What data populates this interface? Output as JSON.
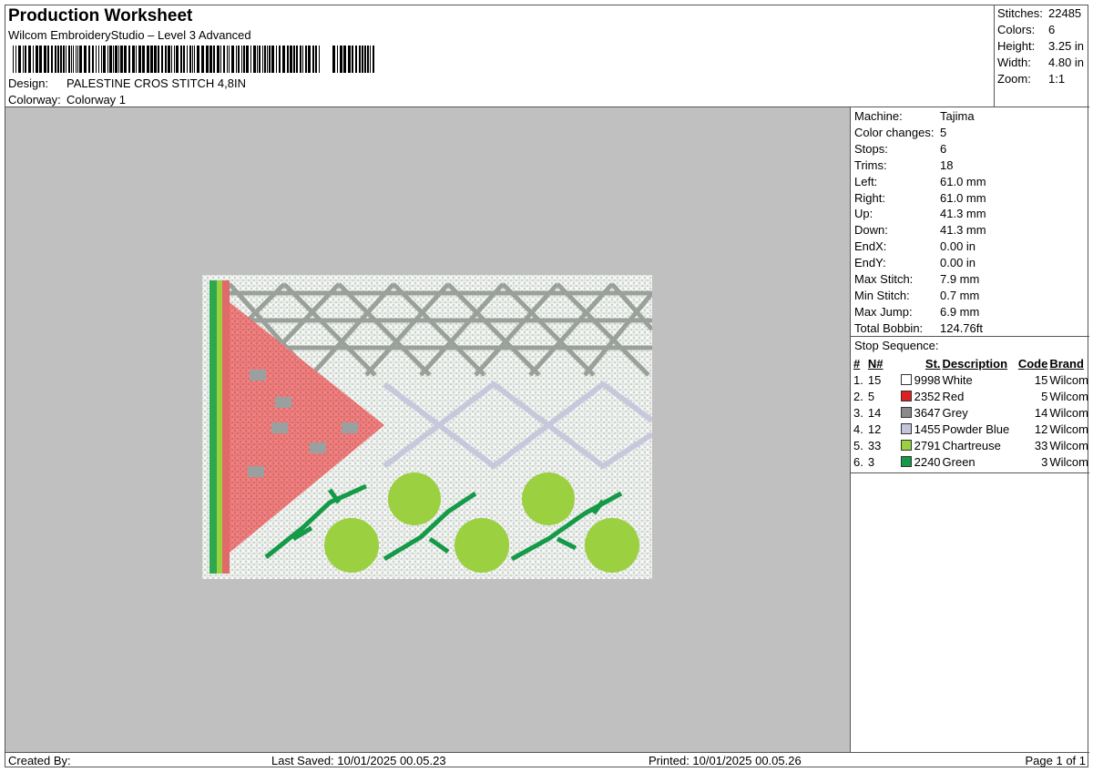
{
  "header": {
    "title": "Production Worksheet",
    "subtitle": "Wilcom EmbroideryStudio – Level 3 Advanced",
    "design_label": "Design:",
    "design_value": "PALESTINE CROS STITCH 4,8IN",
    "colorway_label": "Colorway:",
    "colorway_value": "Colorway 1"
  },
  "summary": {
    "stitches_label": "Stitches:",
    "stitches_value": "22485",
    "colors_label": "Colors:",
    "colors_value": "6",
    "height_label": "Height:",
    "height_value": "3.25 in",
    "width_label": "Width:",
    "width_value": "4.80 in",
    "zoom_label": "Zoom:",
    "zoom_value": "1:1"
  },
  "machine_info": [
    {
      "label": "Machine:",
      "value": "Tajima"
    },
    {
      "label": "Color changes:",
      "value": "5"
    },
    {
      "label": "Stops:",
      "value": "6"
    },
    {
      "label": "Trims:",
      "value": "18"
    },
    {
      "label": "Left:",
      "value": "61.0 mm"
    },
    {
      "label": "Right:",
      "value": "61.0 mm"
    },
    {
      "label": "Up:",
      "value": "41.3 mm"
    },
    {
      "label": "Down:",
      "value": "41.3 mm"
    },
    {
      "label": "EndX:",
      "value": "0.00 in"
    },
    {
      "label": "EndY:",
      "value": "0.00 in"
    },
    {
      "label": "Max Stitch:",
      "value": "7.9 mm"
    },
    {
      "label": "Min Stitch:",
      "value": "0.7 mm"
    },
    {
      "label": "Max Jump:",
      "value": "6.9 mm"
    },
    {
      "label": "Total Bobbin:",
      "value": "124.76ft"
    }
  ],
  "stop_sequence": {
    "title": "Stop Sequence:",
    "headers": {
      "num": "#",
      "n": "N#",
      "st": "St.",
      "desc": "Description",
      "code": "Code",
      "brand": "Brand"
    },
    "rows": [
      {
        "num": "1.",
        "n": "15",
        "st": "9998",
        "desc": "White",
        "code": "15",
        "brand": "Wilcom",
        "color": "#ffffff"
      },
      {
        "num": "2.",
        "n": "5",
        "st": "2352",
        "desc": "Red",
        "code": "5",
        "brand": "Wilcom",
        "color": "#e02020"
      },
      {
        "num": "3.",
        "n": "14",
        "st": "3647",
        "desc": "Grey",
        "code": "14",
        "brand": "Wilcom",
        "color": "#8a8a8a"
      },
      {
        "num": "4.",
        "n": "12",
        "st": "1455",
        "desc": "Powder Blue",
        "code": "12",
        "brand": "Wilcom",
        "color": "#c4c4dc"
      },
      {
        "num": "5.",
        "n": "33",
        "st": "2791",
        "desc": "Chartreuse",
        "code": "33",
        "brand": "Wilcom",
        "color": "#9bd040"
      },
      {
        "num": "6.",
        "n": "3",
        "st": "2240",
        "desc": "Green",
        "code": "3",
        "brand": "Wilcom",
        "color": "#149a48"
      }
    ]
  },
  "footer": {
    "created_by": "Created By:",
    "last_saved": "Last Saved: 10/01/2025 00.05.23",
    "printed": "Printed: 10/01/2025 00.05.26",
    "page": "Page 1 of 1"
  }
}
